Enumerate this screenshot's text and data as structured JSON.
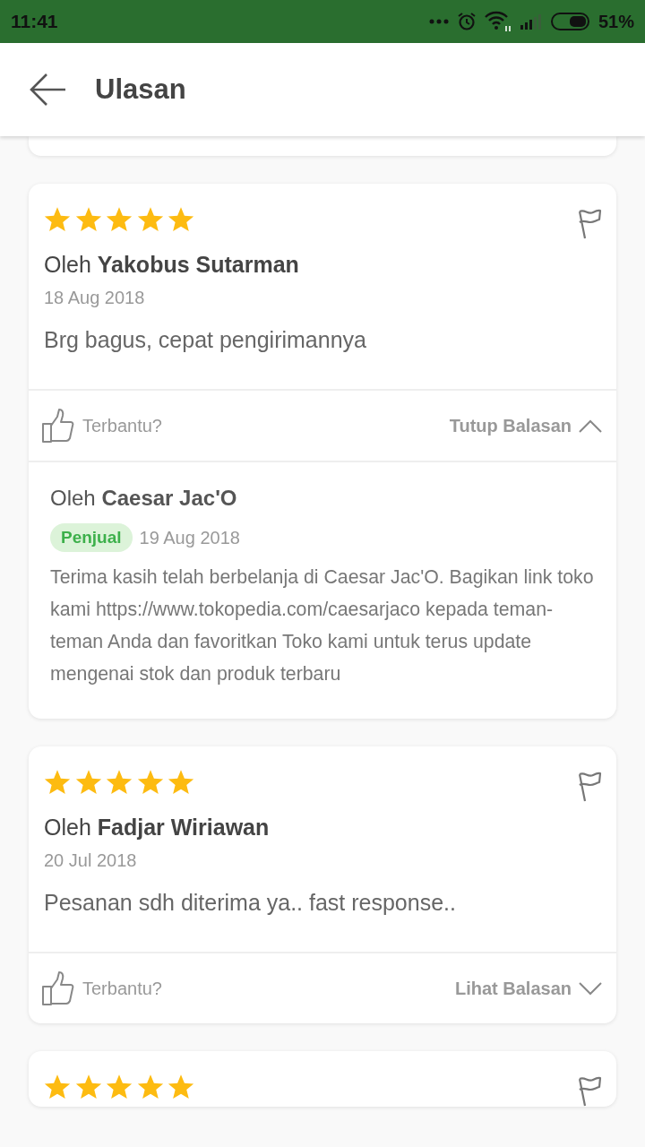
{
  "status_bar": {
    "time": "11:41",
    "battery": "51%"
  },
  "app_bar": {
    "title": "Ulasan"
  },
  "reviews": [
    {
      "stars": 5,
      "author": "Oleh **Yakobus Sutarman**",
      "date": "18 Aug 2018",
      "text": "Brg bagus, cepat pengirimannya",
      "helpful": "Terbantu?",
      "reply_toggle": {
        "label": "Tutup Balasan",
        "expanded": true
      },
      "reply": {
        "author": "Oleh **Caesar Jac'O**",
        "badge": "Penjual",
        "date": "19 Aug 2018",
        "text": "Terima kasih telah berbelanja di Caesar Jac'O. Bagikan link toko kami https://www.tokopedia.com/caesarjaco kepada teman-teman Anda dan favoritkan Toko kami untuk terus update mengenai stok dan produk terbaru"
      }
    },
    {
      "stars": 5,
      "author": "Oleh **Fadjar Wiriawan**",
      "date": "20 Jul 2018",
      "text": "Pesanan sdh diterima ya.. fast response..",
      "helpful": "Terbantu?",
      "reply_toggle": {
        "label": "Lihat Balasan",
        "expanded": false
      }
    },
    {
      "stars": 5
    }
  ]
}
